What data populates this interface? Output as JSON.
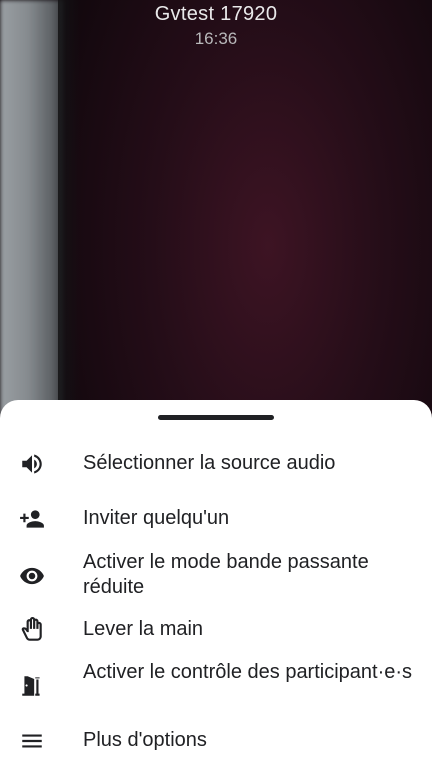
{
  "call": {
    "title": "Gvtest 17920",
    "time": "16:36"
  },
  "menu": {
    "items": [
      {
        "label": "Sélectionner la source audio",
        "icon": "speaker-icon"
      },
      {
        "label": "Inviter quelqu'un",
        "icon": "add-person-icon"
      },
      {
        "label": "Activer le mode bande passante réduite",
        "icon": "eye-icon"
      },
      {
        "label": "Lever la main",
        "icon": "hand-icon"
      },
      {
        "label": "Activer le contrôle des participant·e·s",
        "icon": "door-icon"
      },
      {
        "label": "Plus d'options",
        "icon": "menu-icon"
      }
    ]
  }
}
